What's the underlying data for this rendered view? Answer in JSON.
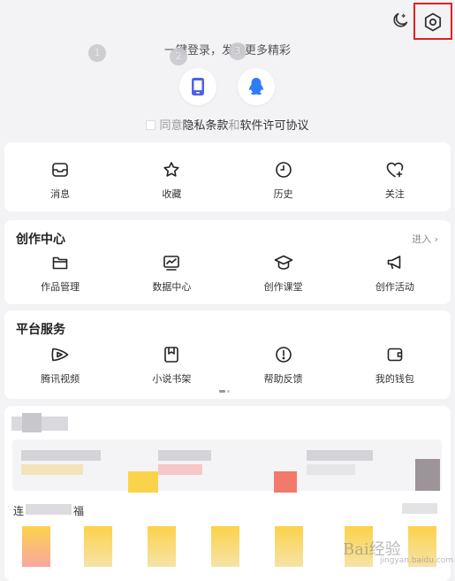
{
  "top_bar": {
    "moon_icon": "moon-icon",
    "settings_icon": "settings-hexagon-icon"
  },
  "login": {
    "prompt": "一键登录，发现更多精彩",
    "step_numbers": [
      "1",
      "2",
      "3"
    ],
    "phone_icon": "phone-icon",
    "qq_icon": "qq-icon",
    "agree_prefix": "同意",
    "privacy_link": "隐私条款",
    "and_text": "和",
    "license_link": "软件许可协议"
  },
  "quick_actions": [
    {
      "label": "消息",
      "icon": "message-box-icon"
    },
    {
      "label": "收藏",
      "icon": "star-icon"
    },
    {
      "label": "历史",
      "icon": "clock-icon"
    },
    {
      "label": "关注",
      "icon": "heart-plus-icon"
    }
  ],
  "creation_center": {
    "title": "创作中心",
    "enter_label": "进入",
    "items": [
      {
        "label": "作品管理",
        "icon": "folder-icon"
      },
      {
        "label": "数据中心",
        "icon": "chart-icon"
      },
      {
        "label": "创作课堂",
        "icon": "graduation-cap-icon"
      },
      {
        "label": "创作活动",
        "icon": "megaphone-icon"
      }
    ]
  },
  "platform_services": {
    "title": "平台服务",
    "items": [
      {
        "label": "腾讯视频",
        "icon": "tencent-video-icon"
      },
      {
        "label": "小说书架",
        "icon": "bookmark-icon"
      },
      {
        "label": "帮助反馈",
        "icon": "help-icon"
      },
      {
        "label": "我的钱包",
        "icon": "wallet-icon"
      }
    ]
  },
  "blurred_section": {
    "lian_text": "连",
    "fu_text": "福"
  },
  "watermark": {
    "text": "Bai经验",
    "sub": "jingyan.baidu.com"
  },
  "colors": {
    "background": "#f3f3f5",
    "card": "#ffffff",
    "highlight_border": "#e02020",
    "phone_icon": "#4b63e6",
    "qq_icon": "#2f7df6"
  }
}
